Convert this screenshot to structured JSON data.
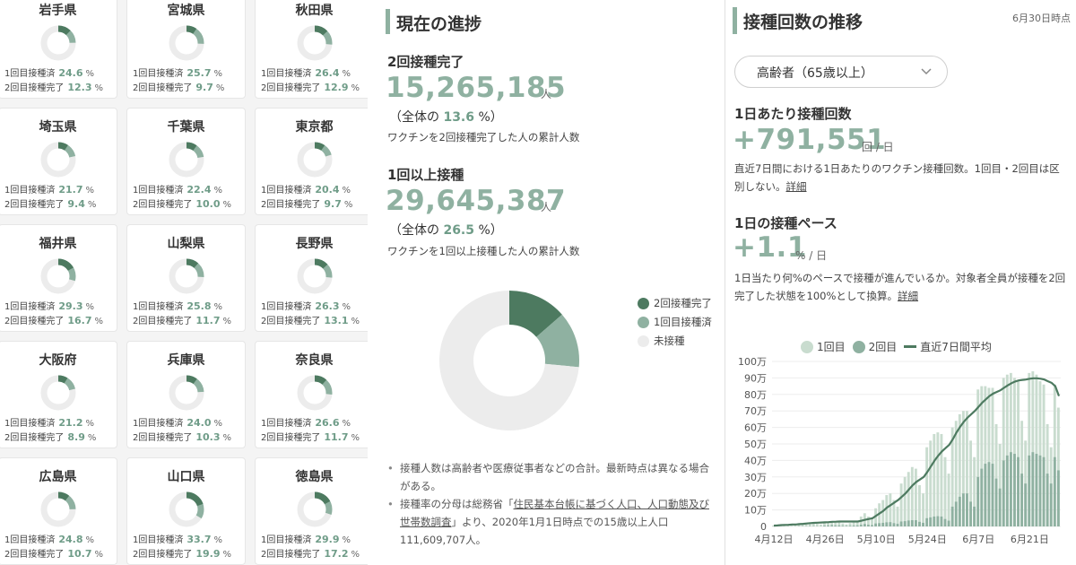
{
  "prefectures": [
    {
      "name": "岩手県",
      "first": "24.6",
      "second": "12.3"
    },
    {
      "name": "宮城県",
      "first": "25.7",
      "second": "9.7"
    },
    {
      "name": "秋田県",
      "first": "26.4",
      "second": "12.9"
    },
    {
      "name": "埼玉県",
      "first": "21.7",
      "second": "9.4"
    },
    {
      "name": "千葉県",
      "first": "22.4",
      "second": "10.0"
    },
    {
      "name": "東京都",
      "first": "20.4",
      "second": "9.7"
    },
    {
      "name": "福井県",
      "first": "29.3",
      "second": "16.7"
    },
    {
      "name": "山梨県",
      "first": "25.8",
      "second": "11.7"
    },
    {
      "name": "長野県",
      "first": "26.3",
      "second": "13.1"
    },
    {
      "name": "大阪府",
      "first": "21.2",
      "second": "8.9"
    },
    {
      "name": "兵庫県",
      "first": "24.0",
      "second": "10.3"
    },
    {
      "name": "奈良県",
      "first": "26.6",
      "second": "11.7"
    },
    {
      "name": "広島県",
      "first": "24.8",
      "second": "10.7"
    },
    {
      "name": "山口県",
      "first": "33.7",
      "second": "19.9"
    },
    {
      "name": "徳島県",
      "first": "29.9",
      "second": "17.2"
    }
  ],
  "pref_labels": {
    "first": "1回目接種済",
    "second": "2回目接種完了",
    "unit": "%"
  },
  "progress": {
    "title": "現在の進捗",
    "second_dose": {
      "label": "2回接種完了",
      "value": "15,265,185",
      "unit": "人",
      "ratio_prefix": "（全体の",
      "ratio": "13.6",
      "ratio_suffix": "%）",
      "desc": "ワクチンを2回接種完了した人の累計人数"
    },
    "first_dose": {
      "label": "1回以上接種",
      "value": "29,645,387",
      "unit": "人",
      "ratio_prefix": "（全体の",
      "ratio": "26.5",
      "ratio_suffix": "%）",
      "desc": "ワクチンを1回以上接種した人の累計人数"
    },
    "donut_legend": [
      "2回接種完了",
      "1回目接種済",
      "未接種"
    ],
    "donut_fractions": {
      "second": 0.136,
      "first_only": 0.129,
      "none": 0.735
    },
    "notes": [
      {
        "text": "接種人数は高齢者や医療従事者などの合計。最新時点は異なる場合がある。"
      },
      {
        "pre": "接種率の分母は総務省「",
        "link": "住民基本台帳に基づく人口、人口動態及び世帯数調査",
        "post": "」より、2020年1月1日時点での15歳以上人口111,609,707人。"
      }
    ]
  },
  "trend": {
    "title": "接種回数の推移",
    "asof": "6月30日時点",
    "select_value": "高齢者（65歳以上）",
    "daily": {
      "label": "1日あたり接種回数",
      "value": "+791,551",
      "unit": "回 / 日",
      "desc": "直近7日間における1日あたりのワクチン接種回数。1回目・2回目は区別しない。",
      "link": "詳細"
    },
    "pace": {
      "label": "1日の接種ペース",
      "value": "+1.1",
      "unit": "% / 日",
      "desc": "1日当たり何%のペースで接種が進んでいるか。対象者全員が接種を2回完了した状態を100%として換算。",
      "link": "詳細"
    },
    "legend": [
      "1回目",
      "2回目",
      "直近7日間平均"
    ]
  },
  "colors": {
    "accent": "#8fb1a1",
    "dark_green": "#4d7a60",
    "mid_green": "#8fb1a1",
    "light_green": "#c9dccf",
    "unvaccinated": "#ececec"
  },
  "chart_data": {
    "type": "bar",
    "x_ticks": [
      "4月12日",
      "4月26日",
      "5月10日",
      "5月24日",
      "6月7日",
      "6月21日"
    ],
    "y_ticks": [
      "0",
      "10万",
      "20万",
      "30万",
      "40万",
      "50万",
      "60万",
      "70万",
      "80万",
      "90万",
      "100万"
    ],
    "ylim": [
      0,
      1000000
    ],
    "dates": [
      "4/12",
      "4/13",
      "4/14",
      "4/15",
      "4/16",
      "4/17",
      "4/18",
      "4/19",
      "4/20",
      "4/21",
      "4/22",
      "4/23",
      "4/24",
      "4/25",
      "4/26",
      "4/27",
      "4/28",
      "4/29",
      "4/30",
      "5/1",
      "5/2",
      "5/3",
      "5/4",
      "5/5",
      "5/6",
      "5/7",
      "5/8",
      "5/9",
      "5/10",
      "5/11",
      "5/12",
      "5/13",
      "5/14",
      "5/15",
      "5/16",
      "5/17",
      "5/18",
      "5/19",
      "5/20",
      "5/21",
      "5/22",
      "5/23",
      "5/24",
      "5/25",
      "5/26",
      "5/27",
      "5/28",
      "5/29",
      "5/30",
      "5/31",
      "6/1",
      "6/2",
      "6/3",
      "6/4",
      "6/5",
      "6/6",
      "6/7",
      "6/8",
      "6/9",
      "6/10",
      "6/11",
      "6/12",
      "6/13",
      "6/14",
      "6/15",
      "6/16",
      "6/17",
      "6/18",
      "6/19",
      "6/20",
      "6/21",
      "6/22",
      "6/23",
      "6/24",
      "6/25",
      "6/26",
      "6/27",
      "6/28",
      "6/29"
    ],
    "series": [
      {
        "name": "1回目",
        "values": [
          5000,
          8000,
          10000,
          12000,
          14000,
          15000,
          10000,
          16000,
          18000,
          20000,
          22000,
          22000,
          16000,
          12000,
          25000,
          28000,
          30000,
          25000,
          26000,
          18000,
          12000,
          20000,
          24000,
          26000,
          60000,
          80000,
          60000,
          50000,
          110000,
          140000,
          160000,
          190000,
          200000,
          160000,
          120000,
          260000,
          300000,
          330000,
          360000,
          350000,
          250000,
          200000,
          480000,
          520000,
          560000,
          570000,
          560000,
          420000,
          320000,
          600000,
          640000,
          680000,
          700000,
          700000,
          520000,
          420000,
          830000,
          850000,
          850000,
          840000,
          840000,
          620000,
          500000,
          900000,
          920000,
          930000,
          900000,
          880000,
          640000,
          520000,
          930000,
          940000,
          920000,
          880000,
          860000,
          620000,
          480000,
          860000,
          720000
        ]
      },
      {
        "name": "2回目",
        "values": [
          0,
          0,
          0,
          0,
          0,
          0,
          0,
          1000,
          1000,
          1000,
          2000,
          2000,
          1000,
          1000,
          5000,
          6000,
          8000,
          6000,
          6000,
          4000,
          3000,
          4000,
          5000,
          6000,
          10000,
          15000,
          10000,
          8000,
          18000,
          20000,
          22000,
          25000,
          26000,
          20000,
          16000,
          30000,
          32000,
          36000,
          38000,
          38000,
          28000,
          22000,
          50000,
          55000,
          60000,
          62000,
          60000,
          45000,
          35000,
          120000,
          150000,
          180000,
          200000,
          200000,
          150000,
          120000,
          300000,
          350000,
          380000,
          390000,
          380000,
          290000,
          230000,
          400000,
          430000,
          450000,
          440000,
          420000,
          320000,
          260000,
          430000,
          450000,
          440000,
          430000,
          420000,
          320000,
          260000,
          420000,
          340000
        ]
      },
      {
        "name": "直近7日間平均",
        "values": [
          5000,
          6000,
          8000,
          9000,
          10000,
          12000,
          12000,
          14000,
          16000,
          18000,
          20000,
          22000,
          23000,
          24000,
          25000,
          26000,
          28000,
          29000,
          30000,
          30000,
          30000,
          30000,
          30000,
          30000,
          35000,
          40000,
          45000,
          50000,
          65000,
          80000,
          95000,
          115000,
          130000,
          145000,
          160000,
          180000,
          200000,
          225000,
          250000,
          270000,
          285000,
          300000,
          330000,
          365000,
          400000,
          430000,
          455000,
          475000,
          495000,
          530000,
          570000,
          605000,
          635000,
          660000,
          680000,
          700000,
          725000,
          750000,
          770000,
          790000,
          805000,
          815000,
          825000,
          840000,
          855000,
          868000,
          878000,
          885000,
          888000,
          890000,
          895000,
          898000,
          898000,
          895000,
          890000,
          880000,
          870000,
          850000,
          790000
        ]
      }
    ]
  }
}
